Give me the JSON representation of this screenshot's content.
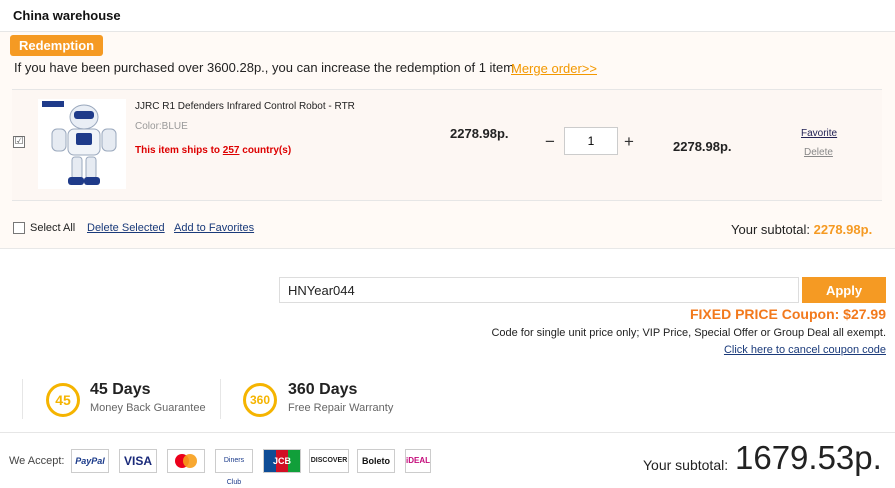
{
  "warehouse": {
    "title": "China warehouse"
  },
  "redemption": {
    "badge": "Redemption",
    "message": "If you have been purchased over 3600.28p., you can increase the redemption of 1 item",
    "merge_link": "Merge order>>"
  },
  "item": {
    "checked_mark": "☑",
    "name": "JJRC R1 Defenders Infrared Control Robot - RTR",
    "color": "Color:BLUE",
    "ships_prefix": "This item ships to ",
    "ships_count": "257",
    "ships_suffix": " country(s)",
    "unit_price": "2278.98p.",
    "quantity": "1",
    "minus": "−",
    "plus": "+",
    "line_total": "2278.98p.",
    "favorite": "Favorite",
    "delete": "Delete"
  },
  "footer": {
    "select_all": "Select All",
    "delete_selected": "Delete Selected",
    "add_to_favorites": "Add to Favorites",
    "subtotal_label": "Your subtotal: ",
    "subtotal_value": "2278.98p."
  },
  "coupon": {
    "code": "HNYear044",
    "apply": "Apply",
    "fixed": "FIXED PRICE Coupon: $27.99",
    "note": "Code for single unit price only; VIP Price, Special Offer or Group Deal all exempt.",
    "cancel": "Click here to cancel coupon code"
  },
  "guarantees": [
    {
      "badge": "45",
      "title": "45 Days",
      "sub": "Money Back Guarantee"
    },
    {
      "badge": "360",
      "title": "360 Days",
      "sub": "Free Repair Warranty"
    }
  ],
  "payments": {
    "label": "We Accept:",
    "methods": [
      "PayPal",
      "VISA",
      "Mastercard",
      "Diners Club",
      "JCB",
      "DISCOVER",
      "Boleto",
      "iDEAL"
    ]
  },
  "total": {
    "label": "Your subtotal:",
    "value": "1679.53p."
  },
  "colors": {
    "accent": "#f59a23",
    "link": "#1a3a7a",
    "alert": "#dd0000"
  }
}
